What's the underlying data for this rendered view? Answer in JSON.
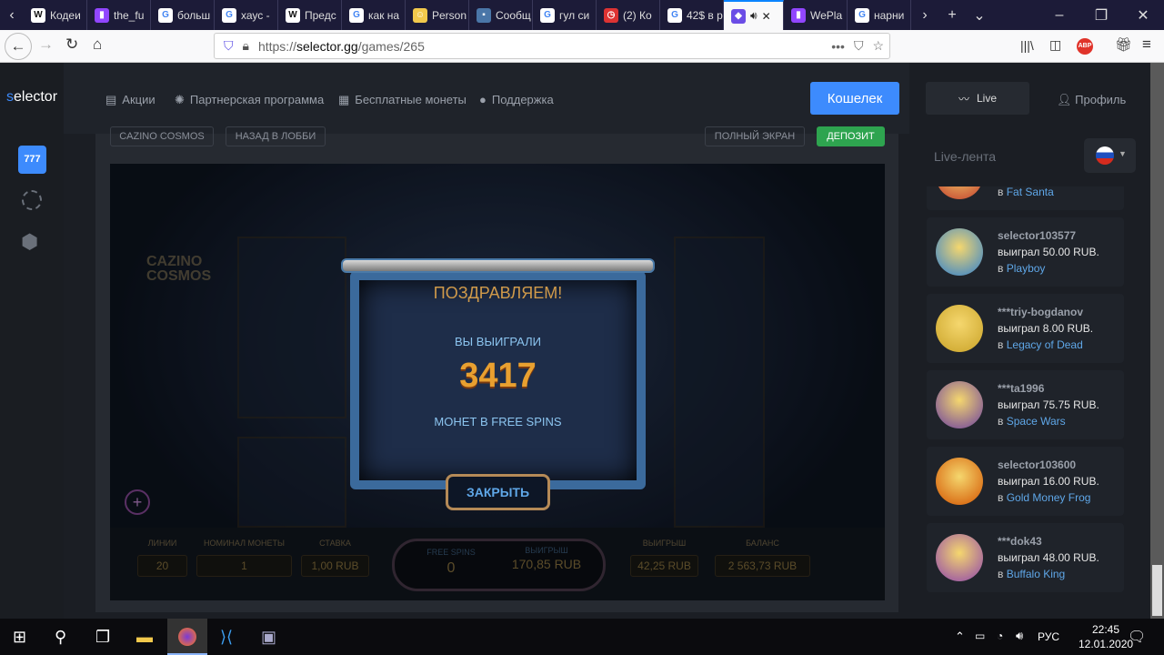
{
  "browser": {
    "tabs": [
      {
        "label": "Кодеи",
        "icon": "W",
        "color": "#fff"
      },
      {
        "label": "the_fu",
        "icon": "twitch",
        "color": "#9146ff"
      },
      {
        "label": "больш",
        "icon": "G",
        "color": "#fff"
      },
      {
        "label": "хаус -",
        "icon": "G",
        "color": "#fff"
      },
      {
        "label": "Предс",
        "icon": "W",
        "color": "#fff"
      },
      {
        "label": "как на",
        "icon": "G",
        "color": "#fff"
      },
      {
        "label": "Person",
        "icon": "face",
        "color": "#f2c94c"
      },
      {
        "label": "Сообщ",
        "icon": "chat",
        "color": "#4a76a8"
      },
      {
        "label": "гул си",
        "icon": "G",
        "color": "#fff"
      },
      {
        "label": "(2) Ко",
        "icon": "clock",
        "color": "#d33"
      },
      {
        "label": "42$ в р",
        "icon": "G",
        "color": "#fff"
      },
      {
        "label": "",
        "icon": "selector",
        "color": "#6b4de6",
        "active": true
      },
      {
        "label": "WePla",
        "icon": "twitch",
        "color": "#9146ff"
      },
      {
        "label": "нарни",
        "icon": "G",
        "color": "#fff"
      }
    ],
    "url_prefix": "https://",
    "url_domain": "selector.gg",
    "url_path": "/games/265"
  },
  "site": {
    "logo_s": "s",
    "logo_rest": "elector",
    "nav": [
      {
        "icon": "list-icon",
        "label": "Акции"
      },
      {
        "icon": "handshake-icon",
        "label": "Партнерская программа"
      },
      {
        "icon": "gift-icon",
        "label": "Бесплатные монеты"
      },
      {
        "icon": "headset-icon",
        "label": "Поддержка"
      }
    ],
    "wallet": "Кошелек",
    "live": "Live",
    "profile": "Профиль",
    "game_name": "CAZINO COSMOS",
    "back_lobby": "НАЗАД В ЛОББИ",
    "fullscreen": "ПОЛНЫЙ ЭКРАН",
    "deposit": "ДЕПОЗИТ"
  },
  "game": {
    "logo": "CAZINO COSMOS",
    "congrats": "ПОЗДРАВЛЯЕМ!",
    "you_won": "ВЫ ВЫИГРАЛИ",
    "amount": "3417",
    "coins_in": "МОНЕТ В FREE SPINS",
    "close": "ЗАКРЫТЬ",
    "bar": {
      "lines_label": "ЛИНИИ",
      "lines": "20",
      "coin_label": "НОМИНАЛ МОНЕТЫ",
      "coin": "1",
      "bet_label": "СТАВКА",
      "bet": "1,00 RUB",
      "fs_label": "FREE SPINS",
      "fs": "0",
      "fswin_label": "ВЫИГРЫШ",
      "fswin": "170,85 RUB",
      "win_label": "ВЫИГРЫШ",
      "win": "42,25 RUB",
      "balance_label": "БАЛАНС",
      "balance": "2 563,73 RUB"
    }
  },
  "feed": {
    "title": "Live-лента",
    "in": "в",
    "items": [
      {
        "user": "",
        "won": "",
        "game": "Fat Santa",
        "color": "#c0392b"
      },
      {
        "user": "selector103577",
        "won": "выиграл 50.00 RUB.",
        "game": "Playboy",
        "color": "#2d7fd1"
      },
      {
        "user": "***triy-bogdanov",
        "won": "выиграл 8.00 RUB.",
        "game": "Legacy of Dead",
        "color": "#c9a227"
      },
      {
        "user": "***ta1996",
        "won": "выиграл 75.75 RUB.",
        "game": "Space Wars",
        "color": "#6a3fa0"
      },
      {
        "user": "selector103600",
        "won": "выиграл 16.00 RUB.",
        "game": "Gold Money Frog",
        "color": "#d35400"
      },
      {
        "user": "***dok43",
        "won": "выиграл 48.00 RUB.",
        "game": "Buffalo King",
        "color": "#8e44ad"
      }
    ]
  },
  "taskbar": {
    "lang": "РУС",
    "time": "22:45",
    "date": "12.01.2020"
  }
}
